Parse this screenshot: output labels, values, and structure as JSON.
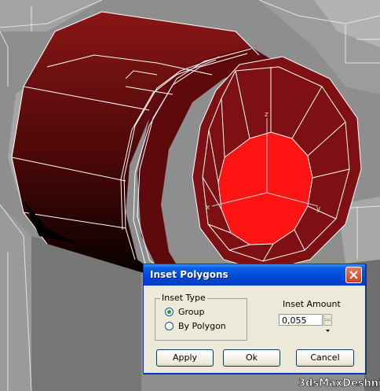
{
  "viewport": {
    "description_colors": {
      "background": "#8f8f8f",
      "mesh": "#7d0f12",
      "selected_face": "#ff1a1a",
      "wire": "#ffffff"
    },
    "watermark": "3dsMaxDeshnik"
  },
  "dialog": {
    "title": "Inset Polygons",
    "inset_type": {
      "legend": "Inset Type",
      "options": [
        {
          "label": "Group",
          "selected": true
        },
        {
          "label": "By Polygon",
          "selected": false
        }
      ]
    },
    "inset_amount": {
      "label": "Inset Amount",
      "value": "0,055"
    },
    "buttons": {
      "apply": "Apply",
      "ok": "Ok",
      "cancel": "Cancel"
    }
  }
}
